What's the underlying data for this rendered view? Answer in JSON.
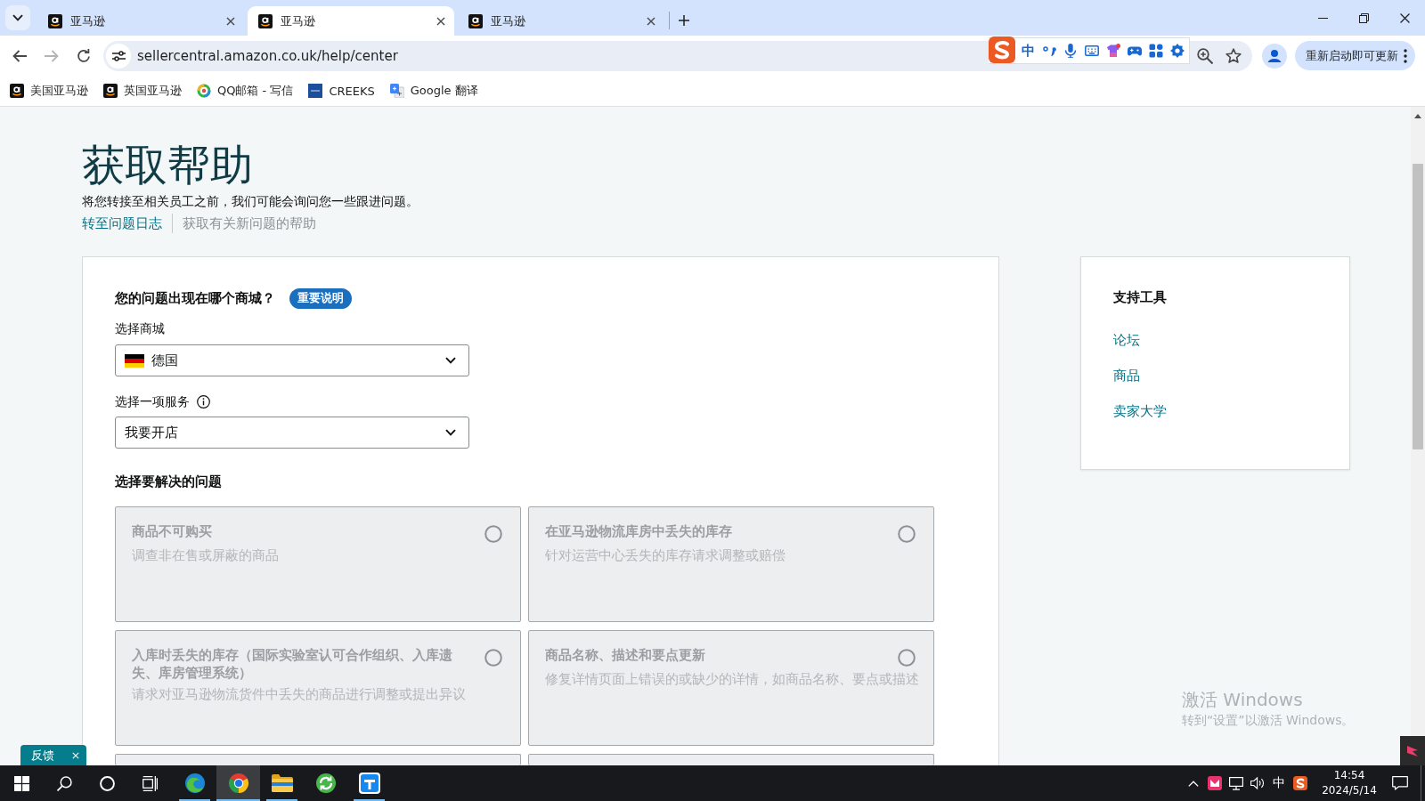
{
  "browser": {
    "tabs": [
      {
        "title": "亚马逊",
        "selected": false
      },
      {
        "title": "亚马逊",
        "selected": true
      },
      {
        "title": "亚马逊",
        "selected": false
      }
    ],
    "address_bar": {
      "url": "sellercentral.amazon.co.uk/help/center"
    },
    "ime_toolbar": {
      "mode": "中"
    },
    "update_button": "重新启动即可更新",
    "bookmarks": [
      {
        "label": "美国亚马逊",
        "kind": "amazon"
      },
      {
        "label": "英国亚马逊",
        "kind": "amazon"
      },
      {
        "label": "QQ邮箱 - 写信",
        "kind": "mail"
      },
      {
        "label": "CREEKS",
        "kind": "square"
      },
      {
        "label": "Google 翻译",
        "kind": "translate"
      }
    ]
  },
  "page": {
    "title": "获取帮助",
    "subtitle": "将您转接至相关员工之前，我们可能会询问您一些跟进问题。",
    "links": [
      {
        "label": "转至问题日志",
        "selected": false
      },
      {
        "label": "获取有关新问题的帮助",
        "selected": true
      }
    ]
  },
  "form": {
    "question": "您的问题出现在哪个商城？",
    "badge": "重要说明",
    "marketplace": {
      "label": "选择商城",
      "value": "德国"
    },
    "service": {
      "label": "选择一项服务",
      "value": "我要开店"
    },
    "issues_heading": "选择要解决的问题",
    "issues": [
      {
        "kind": "option",
        "title": "商品不可购买",
        "description": "调查非在售或屏蔽的商品",
        "disabled": true,
        "selected": false
      },
      {
        "kind": "option",
        "title": "在亚马逊物流库房中丢失的库存",
        "description": "针对运营中心丢失的库存请求调整或赔偿",
        "disabled": true,
        "selected": false
      },
      {
        "kind": "option",
        "title": "入库时丢失的库存（国际实验室认可合作组织、入库遗失、库房管理系统）",
        "description": "请求对亚马逊物流货件中丢失的商品进行调整或提出异议",
        "disabled": true,
        "selected": false
      },
      {
        "kind": "option",
        "title": "商品名称、描述和要点更新",
        "description": "修复详情页面上错误的或缺少的详情，如商品名称、要点或描述",
        "disabled": true,
        "selected": false
      },
      {
        "kind": "cut-off",
        "disabled": true
      },
      {
        "kind": "cut-off",
        "disabled": true
      }
    ]
  },
  "support_tools": {
    "title": "支持工具",
    "links": [
      "论坛",
      "商品",
      "卖家大学"
    ]
  },
  "feedback_tab": {
    "label": "反馈"
  },
  "windows_activation": {
    "title": "激活 Windows",
    "message": "转到“设置”以激活 Windows。"
  },
  "taskbar": {
    "apps": [
      {
        "kind": "swirl",
        "running": true,
        "selected": false
      },
      {
        "kind": "ring",
        "running": true,
        "selected": true
      },
      {
        "kind": "folder",
        "running": true,
        "selected": false
      },
      {
        "kind": "circle",
        "running": false,
        "selected": false
      },
      {
        "kind": "tile",
        "running": true,
        "selected": false
      }
    ],
    "ime": "中",
    "time": "14:54",
    "date": "2024/5/14"
  }
}
